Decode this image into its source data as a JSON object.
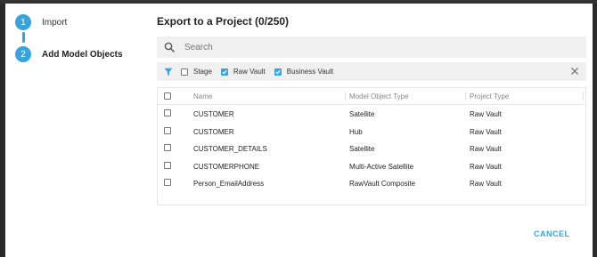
{
  "stepper": {
    "steps": [
      {
        "number": "1",
        "label": "Import"
      },
      {
        "number": "2",
        "label": "Add Model Objects"
      }
    ]
  },
  "dialog": {
    "title": "Export to a Project (0/250)"
  },
  "search": {
    "placeholder": "Search"
  },
  "filters": [
    {
      "label": "Stage",
      "checked": false
    },
    {
      "label": "Raw Vault",
      "checked": true
    },
    {
      "label": "Business Vault",
      "checked": true
    }
  ],
  "table": {
    "headers": [
      "Name",
      "Model Object Type",
      "Project Type"
    ],
    "rows": [
      {
        "name": "CUSTOMER",
        "type": "Satellite",
        "project": "Raw Vault"
      },
      {
        "name": "CUSTOMER",
        "type": "Hub",
        "project": "Raw Vault"
      },
      {
        "name": "CUSTOMER_DETAILS",
        "type": "Satellite",
        "project": "Raw Vault"
      },
      {
        "name": "CUSTOMERPHONE",
        "type": "Multi-Active Satellite",
        "project": "Raw Vault"
      },
      {
        "name": "Person_EmailAddress",
        "type": "RawVault Composite",
        "project": "Raw Vault"
      }
    ]
  },
  "footer": {
    "cancel_label": "CANCEL"
  },
  "colors": {
    "accent": "#3aa3d9",
    "panel": "#f0f0f0"
  }
}
